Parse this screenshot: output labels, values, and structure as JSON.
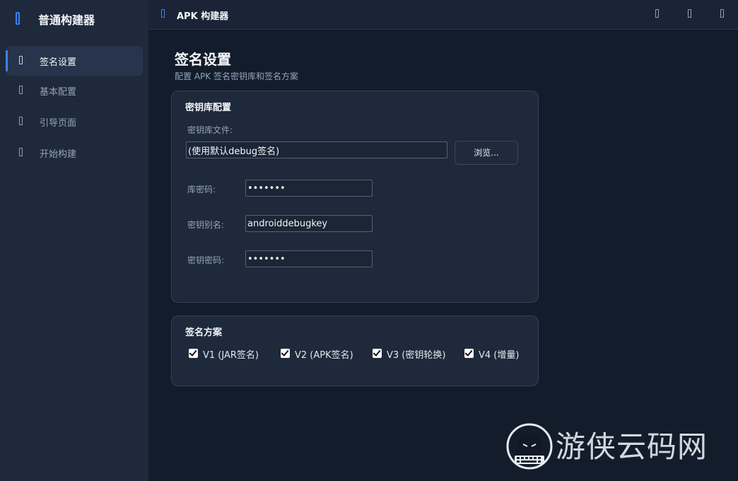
{
  "app": {
    "title": "普通构建器"
  },
  "sidebar": {
    "items": [
      {
        "label": "签名设置",
        "active": true
      },
      {
        "label": "基本配置",
        "active": false
      },
      {
        "label": "引导页面",
        "active": false
      },
      {
        "label": "开始构建",
        "active": false
      }
    ]
  },
  "header": {
    "title": "APK 构建器"
  },
  "page": {
    "title": "签名设置",
    "subtitle": "配置 APK 签名密钥库和签名方案"
  },
  "keystore": {
    "title": "密钥库配置",
    "file_label": "密钥库文件:",
    "file_value": "(使用默认debug签名)",
    "browse_label": "浏览...",
    "store_password_label": "库密码:",
    "store_password_value": "•••••••",
    "alias_label": "密钥别名:",
    "alias_value": "androiddebugkey",
    "key_password_label": "密钥密码:",
    "key_password_value": "•••••••"
  },
  "scheme": {
    "title": "签名方案",
    "options": [
      {
        "label": "V1 (JAR签名)",
        "checked": true
      },
      {
        "label": "V2 (APK签名)",
        "checked": true
      },
      {
        "label": "V3 (密钥轮换)",
        "checked": true
      },
      {
        "label": "V4 (增量)",
        "checked": true
      }
    ]
  },
  "watermark": {
    "text": "游侠云码网"
  },
  "colors": {
    "accent": "#3b82f6",
    "sidebar_bg": "#1e293b",
    "main_bg": "#131c2b",
    "card_bg": "#1e293b",
    "watermark_red": "#e53935"
  },
  "icons": {
    "brand": "app-logo-icon",
    "header": "app-icon",
    "header_buttons": [
      "minimize-icon",
      "maximize-icon",
      "close-icon"
    ]
  }
}
